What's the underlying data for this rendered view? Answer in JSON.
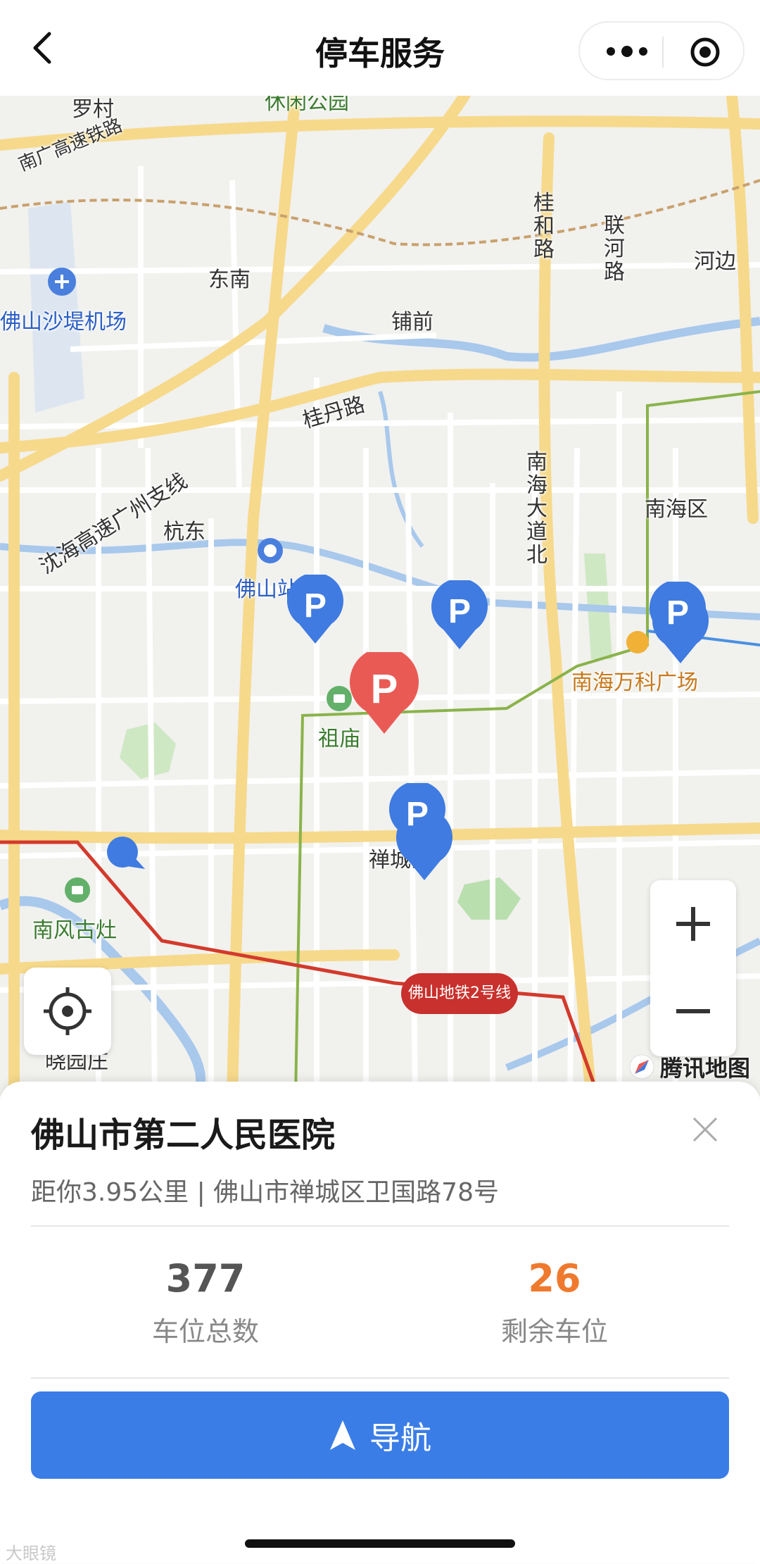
{
  "header": {
    "title": "停车服务"
  },
  "map": {
    "labels": {
      "luocun": "罗村",
      "park": "休闲公园",
      "railway": "南广高速铁路",
      "dongnan": "东南",
      "guihe": "桂和路",
      "lianhe": "联河路",
      "hebian": "河边",
      "airport": "佛山沙堤机场",
      "puqian": "铺前",
      "guidan": "桂丹路",
      "expressway": "沈海高速广州支线",
      "nanhaiave": "南海大道北",
      "nanhaidistrict": "南海区",
      "hangdong": "杭东",
      "station": "佛山站",
      "wanke": "南海万科广场",
      "zumiao": "祖庙",
      "chancheng": "禅城区",
      "nanfeng": "南风古灶",
      "xiaofangzhuang": "晓园庄",
      "metro": "佛山地铁2号线",
      "brand": "腾讯地图"
    },
    "zoom_in_icon": "plus-icon",
    "zoom_out_icon": "minus-icon",
    "locate_icon": "crosshair-icon"
  },
  "sheet": {
    "place_name": "佛山市第二人民医院",
    "address": "距你3.95公里 | 佛山市禅城区卫国路78号",
    "total": {
      "value": "377",
      "label": "车位总数"
    },
    "remaining": {
      "value": "26",
      "label": "剩余车位"
    },
    "navigate_label": "导航"
  },
  "watermark": "大眼镜",
  "colors": {
    "accent": "#3b7de6",
    "remaining": "#ef7a2e",
    "pin_blue": "#3f7be0",
    "pin_red": "#ea5a54",
    "metro_line": "#c8312d"
  }
}
